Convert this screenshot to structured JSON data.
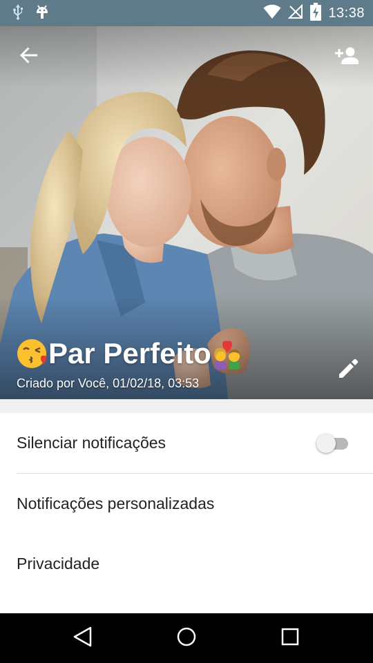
{
  "status_bar": {
    "time": "13:38",
    "icons": [
      "usb-icon",
      "android-debug-icon",
      "wifi-icon",
      "no-signal-icon",
      "battery-charging-icon"
    ]
  },
  "header": {
    "group_name": "Par Perfeito",
    "subtitle": "Criado por Você, 01/02/18, 03:53",
    "icons": [
      "back-arrow-icon",
      "add-participant-icon",
      "edit-pencil-icon"
    ],
    "emoji_left": "face-blowing-kiss",
    "emoji_right": "couple-with-heart"
  },
  "settings": {
    "mute_label": "Silenciar notificações",
    "mute_enabled": false,
    "custom_label": "Notificações personalizadas",
    "privacy_label": "Privacidade"
  },
  "nav_bar": {
    "icons": [
      "nav-back-icon",
      "nav-home-icon",
      "nav-recents-icon"
    ]
  },
  "colors": {
    "status_bar": "#5f7a89",
    "settings_bg": "#ffffff",
    "page_bg": "#f0f0f0"
  }
}
